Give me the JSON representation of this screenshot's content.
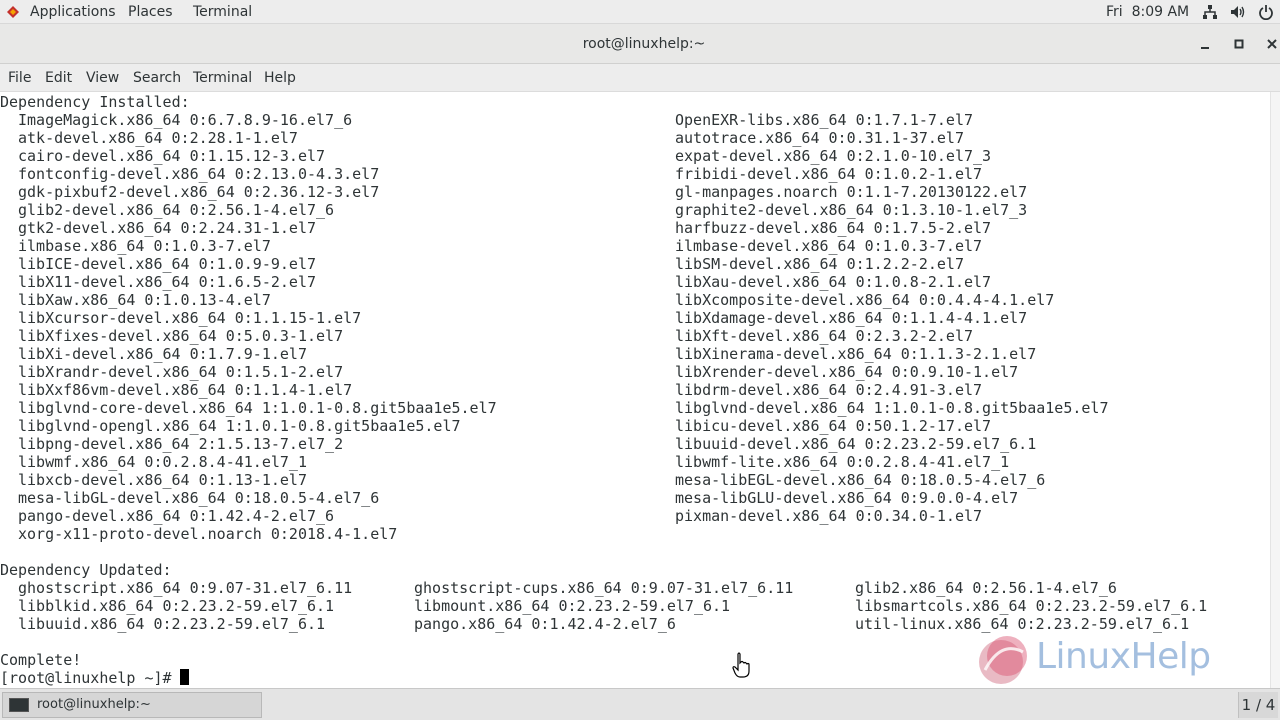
{
  "topbar": {
    "applications": "Applications",
    "places": "Places",
    "terminal": "Terminal",
    "clock": "Fri  8:09 AM",
    "icons": [
      "network-icon",
      "volume-icon",
      "power-icon"
    ]
  },
  "window": {
    "title": "root@linuxhelp:~"
  },
  "menu": [
    "File",
    "Edit",
    "View",
    "Search",
    "Terminal",
    "Help"
  ],
  "terminal": {
    "dep_installed_header": "Dependency Installed:",
    "dep_installed_left": [
      "ImageMagick.x86_64 0:6.7.8.9-16.el7_6",
      "atk-devel.x86_64 0:2.28.1-1.el7",
      "cairo-devel.x86_64 0:1.15.12-3.el7",
      "fontconfig-devel.x86_64 0:2.13.0-4.3.el7",
      "gdk-pixbuf2-devel.x86_64 0:2.36.12-3.el7",
      "glib2-devel.x86_64 0:2.56.1-4.el7_6",
      "gtk2-devel.x86_64 0:2.24.31-1.el7",
      "ilmbase.x86_64 0:1.0.3-7.el7",
      "libICE-devel.x86_64 0:1.0.9-9.el7",
      "libX11-devel.x86_64 0:1.6.5-2.el7",
      "libXaw.x86_64 0:1.0.13-4.el7",
      "libXcursor-devel.x86_64 0:1.1.15-1.el7",
      "libXfixes-devel.x86_64 0:5.0.3-1.el7",
      "libXi-devel.x86_64 0:1.7.9-1.el7",
      "libXrandr-devel.x86_64 0:1.5.1-2.el7",
      "libXxf86vm-devel.x86_64 0:1.1.4-1.el7",
      "libglvnd-core-devel.x86_64 1:1.0.1-0.8.git5baa1e5.el7",
      "libglvnd-opengl.x86_64 1:1.0.1-0.8.git5baa1e5.el7",
      "libpng-devel.x86_64 2:1.5.13-7.el7_2",
      "libwmf.x86_64 0:0.2.8.4-41.el7_1",
      "libxcb-devel.x86_64 0:1.13-1.el7",
      "mesa-libGL-devel.x86_64 0:18.0.5-4.el7_6",
      "pango-devel.x86_64 0:1.42.4-2.el7_6",
      "xorg-x11-proto-devel.noarch 0:2018.4-1.el7"
    ],
    "dep_installed_right": [
      "OpenEXR-libs.x86_64 0:1.7.1-7.el7",
      "autotrace.x86_64 0:0.31.1-37.el7",
      "expat-devel.x86_64 0:2.1.0-10.el7_3",
      "fribidi-devel.x86_64 0:1.0.2-1.el7",
      "gl-manpages.noarch 0:1.1-7.20130122.el7",
      "graphite2-devel.x86_64 0:1.3.10-1.el7_3",
      "harfbuzz-devel.x86_64 0:1.7.5-2.el7",
      "ilmbase-devel.x86_64 0:1.0.3-7.el7",
      "libSM-devel.x86_64 0:1.2.2-2.el7",
      "libXau-devel.x86_64 0:1.0.8-2.1.el7",
      "libXcomposite-devel.x86_64 0:0.4.4-4.1.el7",
      "libXdamage-devel.x86_64 0:1.1.4-4.1.el7",
      "libXft-devel.x86_64 0:2.3.2-2.el7",
      "libXinerama-devel.x86_64 0:1.1.3-2.1.el7",
      "libXrender-devel.x86_64 0:0.9.10-1.el7",
      "libdrm-devel.x86_64 0:2.4.91-3.el7",
      "libglvnd-devel.x86_64 1:1.0.1-0.8.git5baa1e5.el7",
      "libicu-devel.x86_64 0:50.1.2-17.el7",
      "libuuid-devel.x86_64 0:2.23.2-59.el7_6.1",
      "libwmf-lite.x86_64 0:0.2.8.4-41.el7_1",
      "mesa-libEGL-devel.x86_64 0:18.0.5-4.el7_6",
      "mesa-libGLU-devel.x86_64 0:9.0.0-4.el7",
      "pixman-devel.x86_64 0:0.34.0-1.el7"
    ],
    "dep_updated_header": "Dependency Updated:",
    "dep_updated_cols": [
      [
        "ghostscript.x86_64 0:9.07-31.el7_6.11",
        "libblkid.x86_64 0:2.23.2-59.el7_6.1",
        "libuuid.x86_64 0:2.23.2-59.el7_6.1"
      ],
      [
        "ghostscript-cups.x86_64 0:9.07-31.el7_6.11",
        "libmount.x86_64 0:2.23.2-59.el7_6.1",
        "pango.x86_64 0:1.42.4-2.el7_6"
      ],
      [
        "glib2.x86_64 0:2.56.1-4.el7_6",
        "libsmartcols.x86_64 0:2.23.2-59.el7_6.1",
        "util-linux.x86_64 0:2.23.2-59.el7_6.1"
      ]
    ],
    "complete": "Complete!",
    "prompt": "[root@linuxhelp ~]#"
  },
  "watermark": {
    "text": "LinuxHelp"
  },
  "taskbar": {
    "item_label": "root@linuxhelp:~",
    "workspace": "1 / 4"
  }
}
